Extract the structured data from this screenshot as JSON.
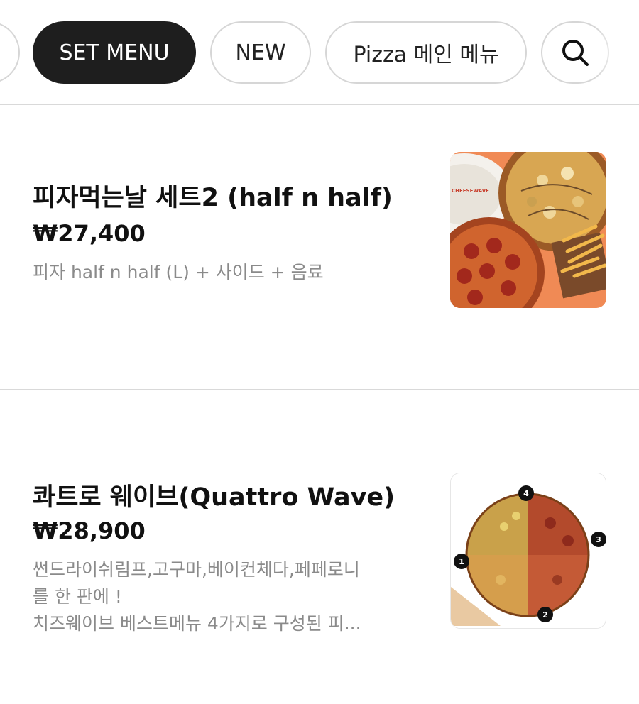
{
  "category_tabs": {
    "items": [
      {
        "label": "SET MENU",
        "active": true
      },
      {
        "label": "NEW",
        "active": false
      },
      {
        "label": "Pizza 메인 메뉴",
        "active": false
      }
    ],
    "search_icon": "search-icon"
  },
  "menu_items": [
    {
      "name": "피자먹는날 세트2 (half n half)",
      "price": "₩27,400",
      "description": "피자 half n half (L) + 사이드 + 음료",
      "image_logo_text": "CHEESEWAVE"
    },
    {
      "name": "콰트로 웨이브(Quattro Wave)",
      "price": "₩28,900",
      "description_lines": [
        "썬드라이쉬림프,고구마,베이컨체다,페페로니",
        "를 한 판에 !",
        "치즈웨이브 베스트메뉴 4가지로 구성된 피..."
      ],
      "image_markers": [
        "1",
        "2",
        "3",
        "4"
      ]
    }
  ],
  "colors": {
    "active_chip": "#1e1e1e",
    "orange_background": "#f08a55",
    "description_text": "#8a8a8a"
  }
}
